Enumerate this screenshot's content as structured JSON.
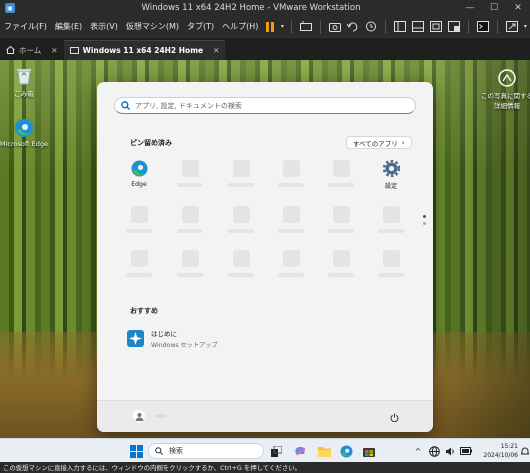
{
  "window": {
    "title": "Windows 11 x64 24H2 Home - VMware Workstation"
  },
  "menu": {
    "items": [
      "ファイル(F)",
      "編集(E)",
      "表示(V)",
      "仮想マシン(M)",
      "タブ(T)",
      "ヘルプ(H)"
    ]
  },
  "tabs": [
    {
      "label": "ホーム"
    },
    {
      "label": "Windows 11 x64 24H2 Home"
    }
  ],
  "desktop": {
    "icons": [
      {
        "label": "ごみ箱",
        "icon": "recycle-bin-icon"
      },
      {
        "label": "Microsoft Edge",
        "icon": "edge-icon"
      },
      {
        "label": "この写真に関する詳細情報",
        "icon": "camera-icon"
      }
    ]
  },
  "start_menu": {
    "search_placeholder": "アプリ, 設定, ドキュメントの検索",
    "pinned_title": "ピン留め済み",
    "all_apps_label": "すべてのアプリ",
    "pinned": [
      {
        "label": "Edge",
        "icon": "edge-icon"
      },
      {
        "label": "設定",
        "icon": "settings-icon"
      }
    ],
    "recommended_title": "おすすめ",
    "recommended": [
      {
        "title": "はじめに",
        "subtitle": "Windows セットアップ",
        "icon": "get-started-icon"
      }
    ]
  },
  "taskbar": {
    "search_label": "検索",
    "time": "15:21",
    "date": "2024/10/06"
  },
  "status_bar": {
    "text": "この仮想マシンに直接入力するには、ウィンドウの内側をクリックするか、Ctrl+G を押してください。"
  },
  "colors": {
    "accent": "#0067c0",
    "edge_blue": "#1d8fd6",
    "edge_green": "#3ebf55",
    "pause_orange": "#f39c12"
  }
}
